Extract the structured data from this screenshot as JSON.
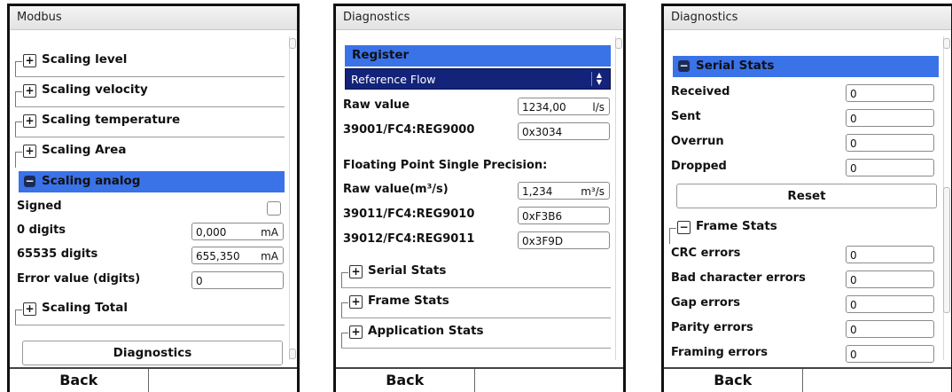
{
  "panel1": {
    "title": "Modbus",
    "tree": [
      "Scaling level",
      "Scaling velocity",
      "Scaling temperature",
      "Scaling Area"
    ],
    "selected": "Scaling analog",
    "fields": [
      {
        "label": "Signed"
      },
      {
        "label": "0 digits",
        "value": "0,000",
        "unit": "mA"
      },
      {
        "label": "65535 digits",
        "value": "655,350",
        "unit": "mA"
      },
      {
        "label": "Error value (digits)",
        "value": "0"
      }
    ],
    "tree_after": "Scaling Total",
    "button": "Diagnostics",
    "back": "Back"
  },
  "panel2": {
    "title": "Diagnostics",
    "register_label": "Register",
    "register_value": "Reference Flow",
    "raw_label": "Raw value",
    "raw_value": "1234,00",
    "raw_unit": "l/s",
    "reg1_label": "39001/FC4:REG9000",
    "reg1_value": "0x3034",
    "float_heading": "Floating Point Single Precision:",
    "raw2_label": "Raw value(m³/s)",
    "raw2_value": "1,234",
    "raw2_unit": "m³/s",
    "reg2_label": "39011/FC4:REG9010",
    "reg2_value": "0xF3B6",
    "reg3_label": "39012/FC4:REG9011",
    "reg3_value": "0x3F9D",
    "tree": [
      "Serial Stats",
      "Frame Stats",
      "Application Stats"
    ],
    "back": "Back"
  },
  "panel3": {
    "title": "Diagnostics",
    "selected": "Serial Stats",
    "serial": [
      {
        "label": "Received",
        "value": "0"
      },
      {
        "label": "Sent",
        "value": "0"
      },
      {
        "label": "Overrun",
        "value": "0"
      },
      {
        "label": "Dropped",
        "value": "0"
      }
    ],
    "reset": "Reset",
    "frame_heading": "Frame Stats",
    "frame": [
      {
        "label": "CRC errors",
        "value": "0"
      },
      {
        "label": "Bad character errors",
        "value": "0"
      },
      {
        "label": "Gap errors",
        "value": "0"
      },
      {
        "label": "Parity errors",
        "value": "0"
      },
      {
        "label": "Framing errors",
        "value": "0"
      }
    ],
    "back": "Back"
  },
  "icons": {
    "plus": "plus-box-icon",
    "minus": "minus-box-icon",
    "dropdown": "up-down-arrow-icon"
  }
}
